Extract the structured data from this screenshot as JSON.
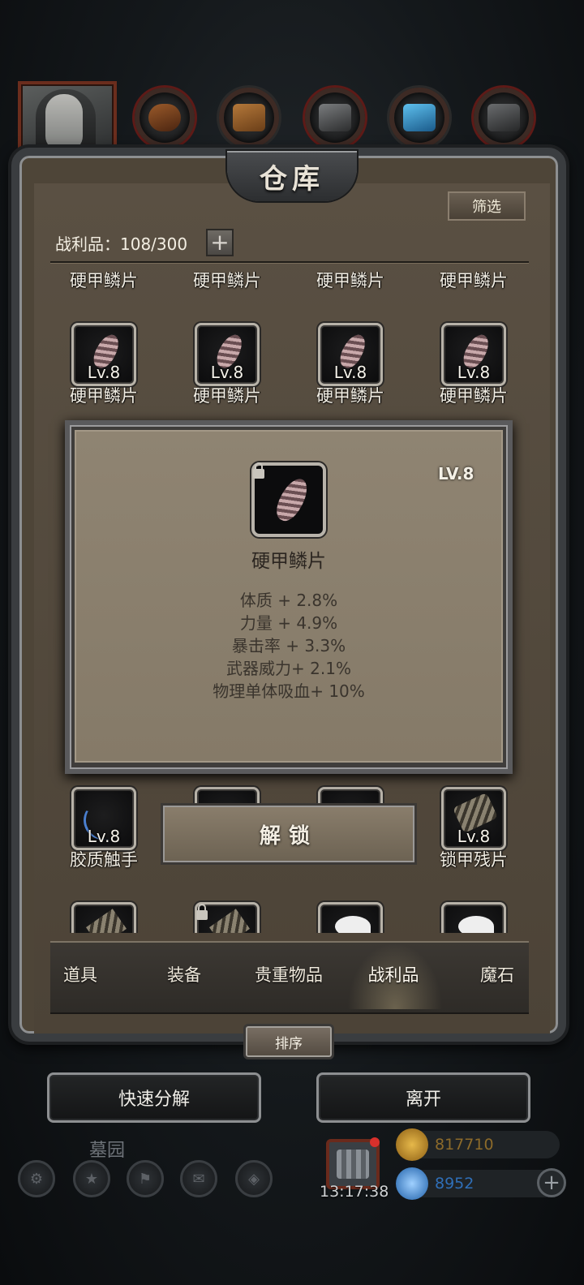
{
  "title": "仓库",
  "filter_label": "筛选",
  "loot": {
    "label": "战利品：108/300",
    "add_symbol": "+"
  },
  "grid": {
    "row1_labels": [
      "硬甲鳞片",
      "硬甲鳞片",
      "硬甲鳞片",
      "硬甲鳞片"
    ],
    "row2": [
      {
        "level": "Lv.8",
        "name": "硬甲鳞片"
      },
      {
        "level": "Lv.8",
        "name": "硬甲鳞片"
      },
      {
        "level": "Lv.8",
        "name": "硬甲鳞片"
      },
      {
        "level": "Lv.8",
        "name": "硬甲鳞片"
      }
    ],
    "row4": [
      {
        "level": "Lv.8",
        "name": "胶质触手"
      },
      {
        "level": "Lv.8",
        "name": "锁甲残片"
      }
    ]
  },
  "popup": {
    "level": "LV.8",
    "name": "硬甲鳞片",
    "stats": [
      "体质 + 2.8%",
      "力量 + 4.9%",
      "暴击率 + 3.3%",
      "武器威力+ 2.1%",
      "物理单体吸血+ 10%"
    ]
  },
  "unlock_label": "解锁",
  "tabs": [
    {
      "label": "道具",
      "active": false
    },
    {
      "label": "装备",
      "active": false
    },
    {
      "label": "贵重物品",
      "active": false
    },
    {
      "label": "战利品",
      "active": true
    },
    {
      "label": "魔石",
      "active": false
    }
  ],
  "sort_label": "排序",
  "quick_decompose_label": "快速分解",
  "leave_label": "离开",
  "hud": {
    "map_name": "墓园",
    "clock": "13:17:38",
    "gold": "817710",
    "gems": "8952"
  },
  "colors": {
    "panel_bg": "#4e4538",
    "popup_bg": "#8f8472",
    "gold_text": "#8c6a2a",
    "gem_text": "#2f6fb8"
  },
  "icons": [
    "portrait-icon",
    "boots-icon",
    "cloak-icon",
    "armor-plate-icon",
    "crystal-icon",
    "gauntlet-icon",
    "armor-scale-icon",
    "tentacle-icon",
    "chain-fragment-icon",
    "lock-icon",
    "gift-icon",
    "gold-coin-icon",
    "gem-icon",
    "plus-icon"
  ]
}
